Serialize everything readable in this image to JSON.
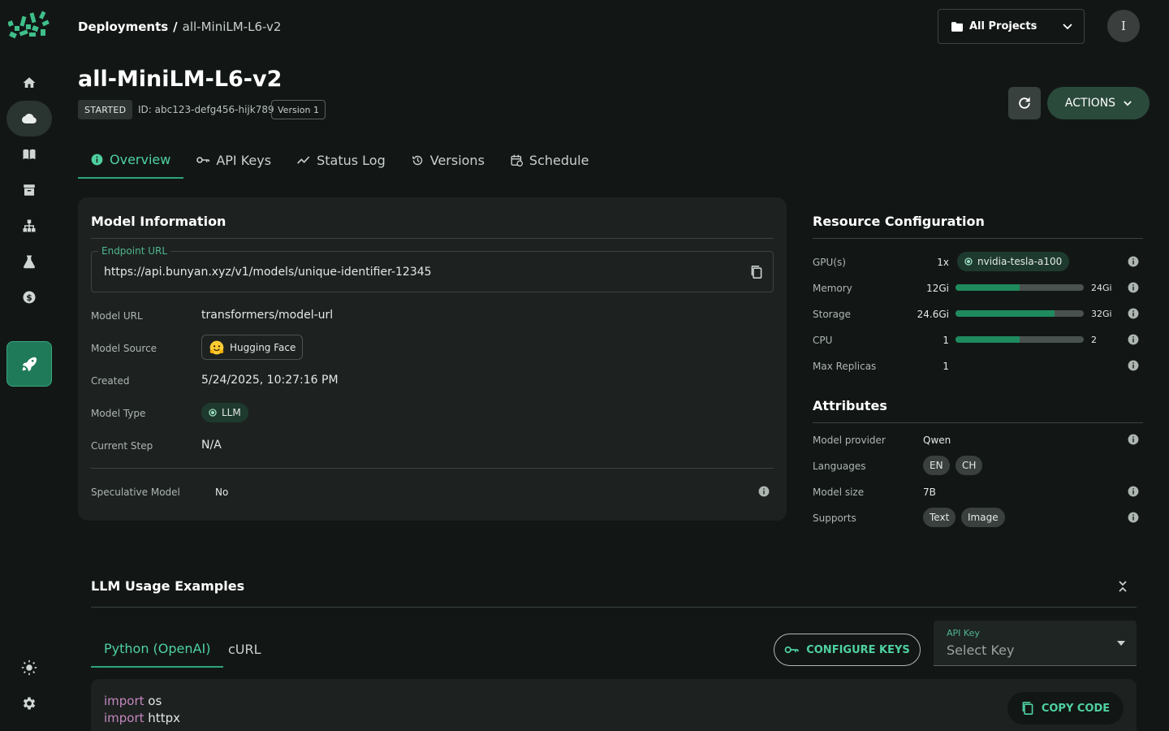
{
  "breadcrumb": {
    "root": "Deployments",
    "separator": "/",
    "current": "all-MiniLM-L6-v2"
  },
  "project_select": {
    "label": "All Projects"
  },
  "user": {
    "initial": "I"
  },
  "deployment": {
    "title": "all-MiniLM-L6-v2",
    "status": "STARTED",
    "id": "ID: abc123-defg456-hijk789",
    "version": "Version 1"
  },
  "header_actions": {
    "actions_label": "ACTIONS"
  },
  "tabs": [
    {
      "label": "Overview",
      "icon": "info-icon",
      "active": true
    },
    {
      "label": "API Keys",
      "icon": "key-icon"
    },
    {
      "label": "Status Log",
      "icon": "trend-icon"
    },
    {
      "label": "Versions",
      "icon": "history-icon"
    },
    {
      "label": "Schedule",
      "icon": "calendar-icon"
    }
  ],
  "model_info": {
    "heading": "Model Information",
    "endpoint_label": "Endpoint URL",
    "endpoint_url": "https://api.bunyan.xyz/v1/models/unique-identifier-12345",
    "rows": {
      "model_url": {
        "label": "Model URL",
        "value": "transformers/model-url"
      },
      "model_source": {
        "label": "Model Source",
        "value": "Hugging Face"
      },
      "created": {
        "label": "Created",
        "value": "5/24/2025, 10:27:16 PM"
      },
      "model_type": {
        "label": "Model Type",
        "value": "LLM"
      },
      "current_step": {
        "label": "Current Step",
        "value": "N/A"
      },
      "speculative": {
        "label": "Speculative Model",
        "value": "No"
      }
    }
  },
  "resources": {
    "heading": "Resource Configuration",
    "gpu": {
      "label": "GPU(s)",
      "count": "1x",
      "type": "nvidia-tesla-a100"
    },
    "memory": {
      "label": "Memory",
      "used": "12Gi",
      "max": "24Gi",
      "fraction": 0.5
    },
    "storage": {
      "label": "Storage",
      "used": "24.6Gi",
      "max": "32Gi",
      "fraction": 0.77
    },
    "cpu": {
      "label": "CPU",
      "used": "1",
      "max": "2",
      "fraction": 0.5
    },
    "replicas": {
      "label": "Max Replicas",
      "value": "1"
    }
  },
  "attributes": {
    "heading": "Attributes",
    "provider": {
      "label": "Model provider",
      "value": "Qwen"
    },
    "languages": {
      "label": "Languages",
      "values": [
        "EN",
        "CH"
      ]
    },
    "size": {
      "label": "Model size",
      "value": "7B"
    },
    "supports": {
      "label": "Supports",
      "values": [
        "Text",
        "Image"
      ]
    }
  },
  "usage": {
    "heading": "LLM Usage Examples",
    "tabs": [
      "Python (OpenAI)",
      "cURL"
    ],
    "configure_keys": "CONFIGURE KEYS",
    "api_key_label": "API Key",
    "api_key_placeholder": "Select Key",
    "copy_code": "COPY CODE",
    "code_lines": [
      {
        "kw": "import",
        "rest": " os"
      },
      {
        "kw": "import",
        "rest": " httpx"
      }
    ]
  },
  "colors": {
    "accent": "#4fd1a1",
    "background": "#121715",
    "card": "#1d2220",
    "bar_fill": "#1f8a5e"
  }
}
